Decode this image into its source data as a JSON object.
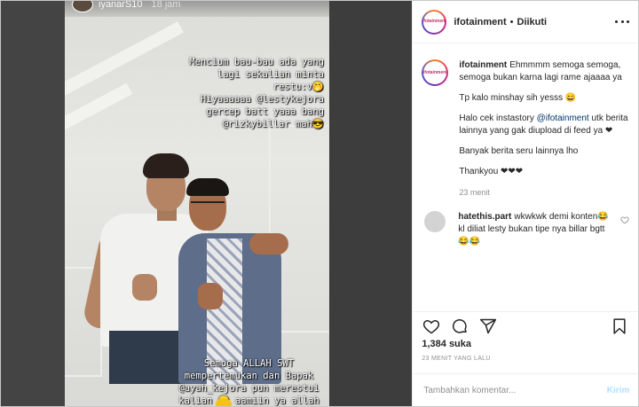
{
  "story": {
    "username": "iyanarS10",
    "time": "18 jam",
    "caption_top": "Mencium bau-bau ada yang\nlagi sekalian minta\nrestu:v🤭\nHiyaaaaaa @lestykejora\ngercep batt yaaa bang\n@rizkybillar mah😎",
    "caption_bottom": "Semoga ALLAH SWT\nmempertemukan dan Bapak\n@ayah_kejora pun merestui\nkalian 😊 aamiin ya allah"
  },
  "header": {
    "username": "ifotainment",
    "dot": "•",
    "follow_status": "Diikuti",
    "avatar_text": "ifotainment"
  },
  "caption": {
    "username": "ifotainment",
    "line1": "Ehmmmm semoga semoga, semoga bukan karna lagi rame ajaaaa ya",
    "line2": "Tp kalo minshay sih yesss 😄",
    "line3_pre": "Halo cek instastory ",
    "line3_mention": "@ifotainment",
    "line3_post": " utk berita lainnya yang gak diupload di feed ya ❤",
    "line4": "Banyak berita seru lainnya lho",
    "line5": "Thankyou ❤❤❤",
    "time": "23 menit"
  },
  "comment": {
    "username": "hatethis.part",
    "text": "wkwkwk demi konten😂 kl diliat lesty bukan tipe nya billar bgtt😂😂"
  },
  "actions": {
    "likes": "1,384 suka",
    "post_time": "23 MENIT YANG LALU"
  },
  "add_comment": {
    "placeholder": "Tambahkan komentar...",
    "post_label": "Kirim"
  },
  "icons": [
    "heart-icon",
    "comment-icon",
    "share-icon",
    "bookmark-icon",
    "more-icon"
  ]
}
